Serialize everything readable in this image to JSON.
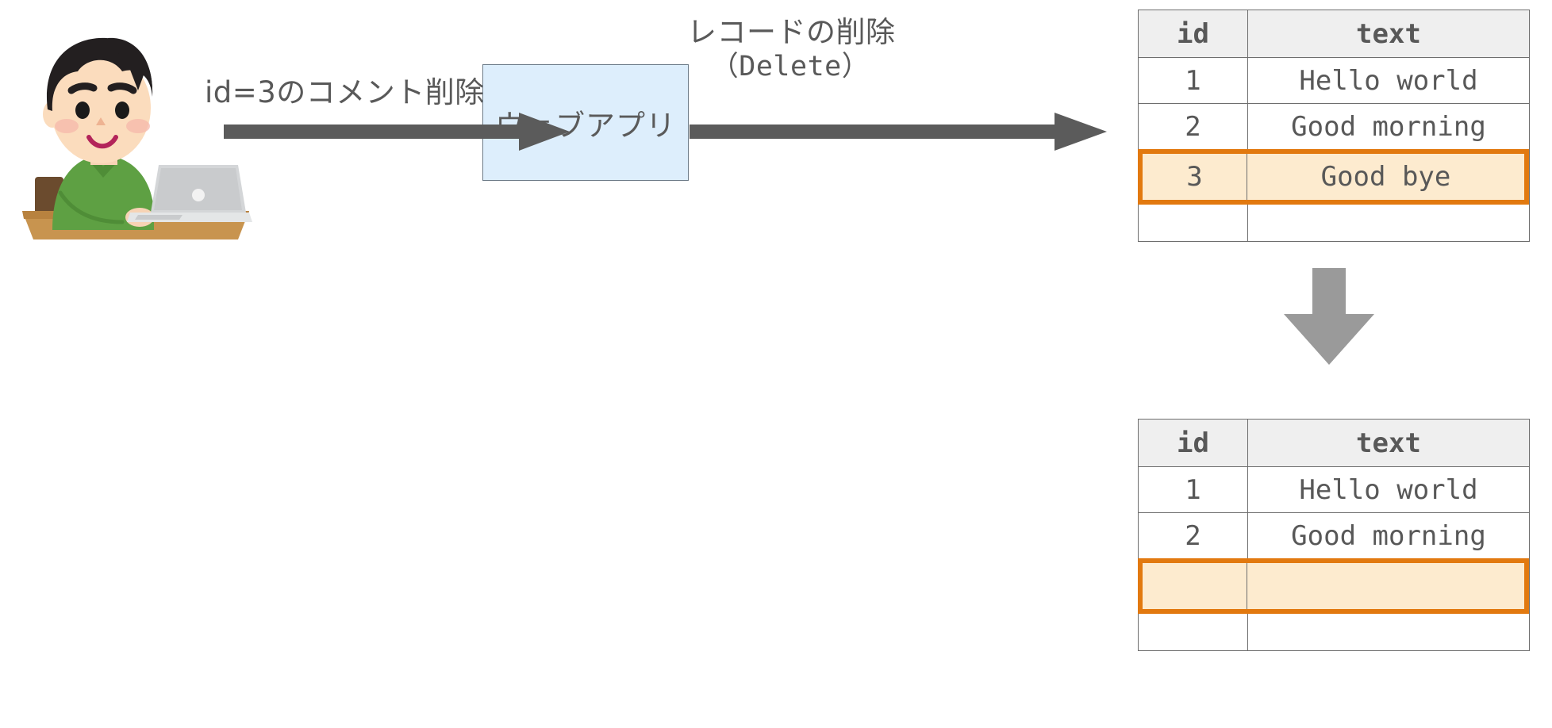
{
  "diagram": {
    "title_semantic": "delete-record-flow",
    "actor": {
      "alt": "person-using-laptop-illustration"
    },
    "labels": {
      "user_action": "id=3のコメント削除",
      "record_delete_line1": "レコードの削除",
      "record_delete_line2": "（Delete）"
    },
    "webapp": {
      "label": "ウェブアプリ",
      "fill": "#ddeefc",
      "border": "#6b7a87"
    },
    "arrows": {
      "user_to_app": "arrow-right",
      "app_to_db": "arrow-right",
      "before_to_after": "arrow-down",
      "color": "#5b5b5b",
      "down_color": "#9a9a9a"
    },
    "highlight": {
      "border_color": "#e2790f",
      "fill_color": "#fdebcf"
    }
  },
  "tables": {
    "before": {
      "name": "table-before-delete",
      "headers": [
        "id",
        "text"
      ],
      "rows": [
        {
          "id": "1",
          "text": "Hello world",
          "highlighted": false
        },
        {
          "id": "2",
          "text": "Good morning",
          "highlighted": false
        },
        {
          "id": "3",
          "text": "Good bye",
          "highlighted": true
        },
        {
          "id": "",
          "text": "",
          "highlighted": false
        }
      ],
      "highlight_row": {
        "id": "3",
        "text": "Good bye"
      }
    },
    "after": {
      "name": "table-after-delete",
      "headers": [
        "id",
        "text"
      ],
      "rows": [
        {
          "id": "1",
          "text": "Hello world",
          "highlighted": false
        },
        {
          "id": "2",
          "text": "Good morning",
          "highlighted": false
        },
        {
          "id": "",
          "text": "",
          "highlighted": true
        },
        {
          "id": "",
          "text": "",
          "highlighted": false
        }
      ],
      "highlight_row": {
        "id": "",
        "text": ""
      }
    }
  }
}
